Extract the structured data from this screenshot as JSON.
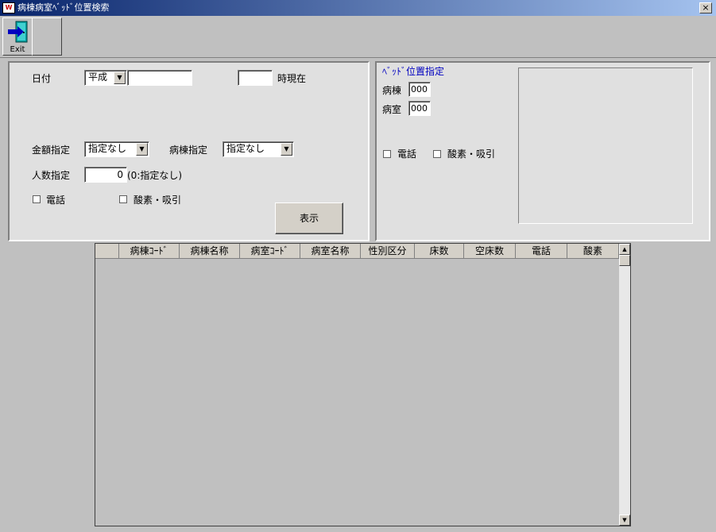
{
  "window": {
    "title": "病棟病室ﾍﾞｯﾄﾞ位置検索",
    "icon_text": "W",
    "close_glyph": "×"
  },
  "toolbar": {
    "exit_label": "Exit",
    "exit_icon": "exit-door-icon"
  },
  "search": {
    "date_label": "日付",
    "era_value": "平成",
    "date_value": "",
    "time_value": "",
    "time_suffix": "時現在",
    "amount_label": "金額指定",
    "amount_value": "指定なし",
    "ward_label": "病棟指定",
    "ward_value": "指定なし",
    "people_label": "人数指定",
    "people_value": "0",
    "people_hint": "(0:指定なし)",
    "phone_label": "電話",
    "oxygen_label": "酸素・吸引",
    "show_button": "表示"
  },
  "bed": {
    "heading": "ﾍﾞｯﾄﾞ位置指定",
    "ward_label": "病棟",
    "ward_value": "000",
    "room_label": "病室",
    "room_value": "000",
    "phone_label": "電話",
    "oxygen_label": "酸素・吸引"
  },
  "table": {
    "columns": [
      "",
      "病棟ｺｰﾄﾞ",
      "病棟名称",
      "病室ｺｰﾄﾞ",
      "病室名称",
      "性別区分",
      "床数",
      "空床数",
      "電話",
      "酸素"
    ],
    "rows": []
  },
  "colors": {
    "title_start": "#08246b",
    "title_end": "#a5c3ef",
    "heading_blue": "#0000c0",
    "panel_bg": "#e0e0e0",
    "window_bg": "#c0c0c0"
  }
}
